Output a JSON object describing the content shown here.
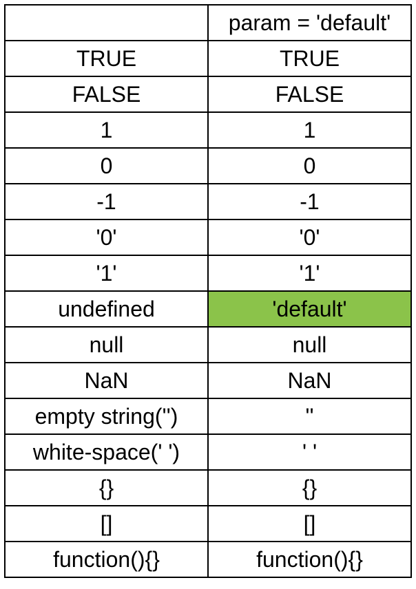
{
  "table": {
    "header_right": "param = 'default'",
    "rows": [
      {
        "left": "TRUE",
        "right": "TRUE",
        "highlight": false
      },
      {
        "left": "FALSE",
        "right": "FALSE",
        "highlight": false
      },
      {
        "left": "1",
        "right": "1",
        "highlight": false
      },
      {
        "left": "0",
        "right": "0",
        "highlight": false
      },
      {
        "left": "-1",
        "right": "-1",
        "highlight": false
      },
      {
        "left": "'0'",
        "right": "'0'",
        "highlight": false
      },
      {
        "left": "'1'",
        "right": "'1'",
        "highlight": false
      },
      {
        "left": "undefined",
        "right": "'default'",
        "highlight": true
      },
      {
        "left": "null",
        "right": "null",
        "highlight": false
      },
      {
        "left": "NaN",
        "right": "NaN",
        "highlight": false
      },
      {
        "left": "empty string('')",
        "right": "''",
        "highlight": false
      },
      {
        "left": "white-space('  ')",
        "right": "'  '",
        "highlight": false
      },
      {
        "left": "{}",
        "right": "{}",
        "highlight": false
      },
      {
        "left": "[]",
        "right": "[]",
        "highlight": false
      },
      {
        "left": "function(){}",
        "right": "function(){}",
        "highlight": false
      }
    ]
  }
}
